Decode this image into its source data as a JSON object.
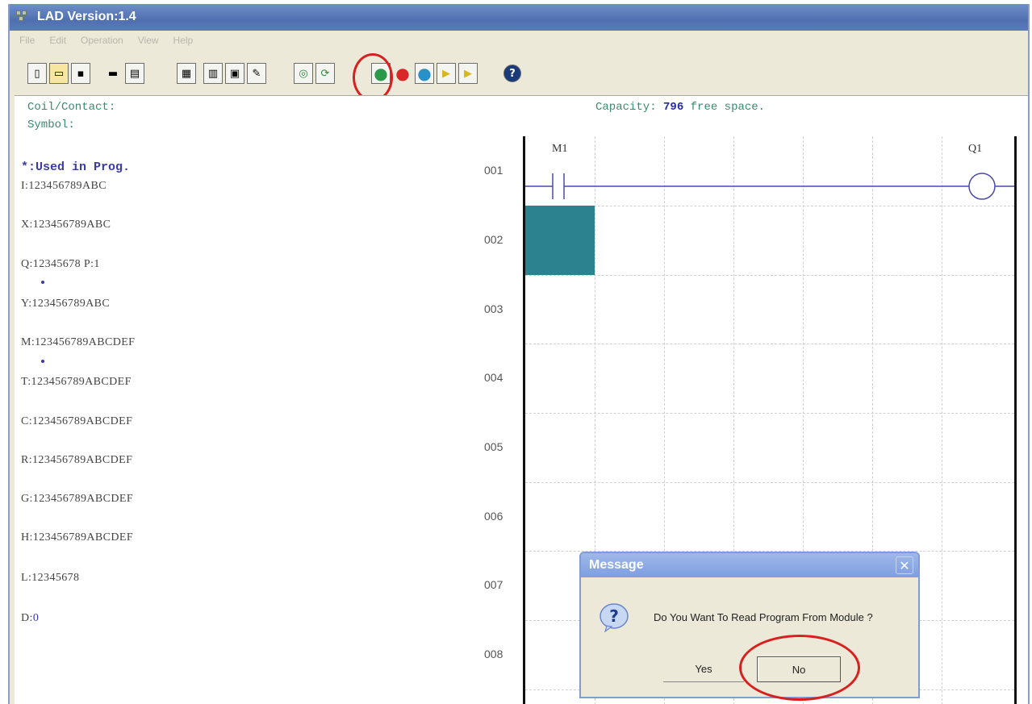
{
  "window": {
    "title": "LAD Version:1.4"
  },
  "menu": [
    "File",
    "Edit",
    "Operation",
    "View",
    "Help"
  ],
  "toolbar": {
    "buttons": [
      {
        "name": "new-file-icon",
        "glyph": "▯"
      },
      {
        "name": "open-folder-icon",
        "glyph": "▭"
      },
      {
        "name": "save-icon",
        "glyph": "▪"
      },
      {
        "name": "print-icon",
        "glyph": "▬"
      },
      {
        "name": "print-preview-icon",
        "glyph": "▤"
      },
      {
        "name": "monitor-icon",
        "glyph": "▦"
      },
      {
        "name": "ladder-view-icon",
        "glyph": "▥"
      },
      {
        "name": "window-icon",
        "glyph": "▣"
      },
      {
        "name": "edit-icon",
        "glyph": "✎"
      },
      {
        "name": "connect-icon",
        "glyph": "◎"
      },
      {
        "name": "refresh-icon",
        "glyph": "⟳"
      },
      {
        "name": "read-from-module-icon",
        "glyph": "●"
      },
      {
        "name": "stop-icon",
        "glyph": "●"
      },
      {
        "name": "run-icon",
        "glyph": "●"
      },
      {
        "name": "write-to-module-icon",
        "glyph": "▶"
      },
      {
        "name": "compare-icon",
        "glyph": "▶"
      },
      {
        "name": "help-icon",
        "glyph": "?"
      }
    ]
  },
  "info": {
    "coil_contact_label": "Coil/Contact:",
    "symbol_label": "Symbol:",
    "capacity_label": "Capacity:",
    "capacity_value": "796",
    "capacity_suffix": "free space."
  },
  "registers": {
    "used_label": "*:Used in Prog.",
    "I": "I:123456789ABC",
    "X": "X:123456789ABC",
    "Q": "Q:12345678  P:1",
    "Y": "Y:123456789ABC",
    "M": "M:123456789ABCDEF",
    "T": "T:123456789ABCDEF",
    "C": "C:123456789ABCDEF",
    "R": "R:123456789ABCDEF",
    "G": "G:123456789ABCDEF",
    "H": "H:123456789ABCDEF",
    "L": "L:12345678",
    "D_prefix": "D:",
    "D_value": "0"
  },
  "ladder": {
    "rows": [
      "001",
      "002",
      "003",
      "004",
      "005",
      "006",
      "007",
      "008"
    ],
    "contact_label": "M1",
    "coil_label": "Q1"
  },
  "dialog": {
    "title": "Message",
    "message": "Do You Want To Read Program From Module ?",
    "yes_label": "Yes",
    "no_label": "No"
  },
  "colors": {
    "accent_highlight": "#d82020",
    "cursor_cell": "#2d8290",
    "used_text": "#3a3aa8",
    "info_text": "#3a8a70"
  }
}
